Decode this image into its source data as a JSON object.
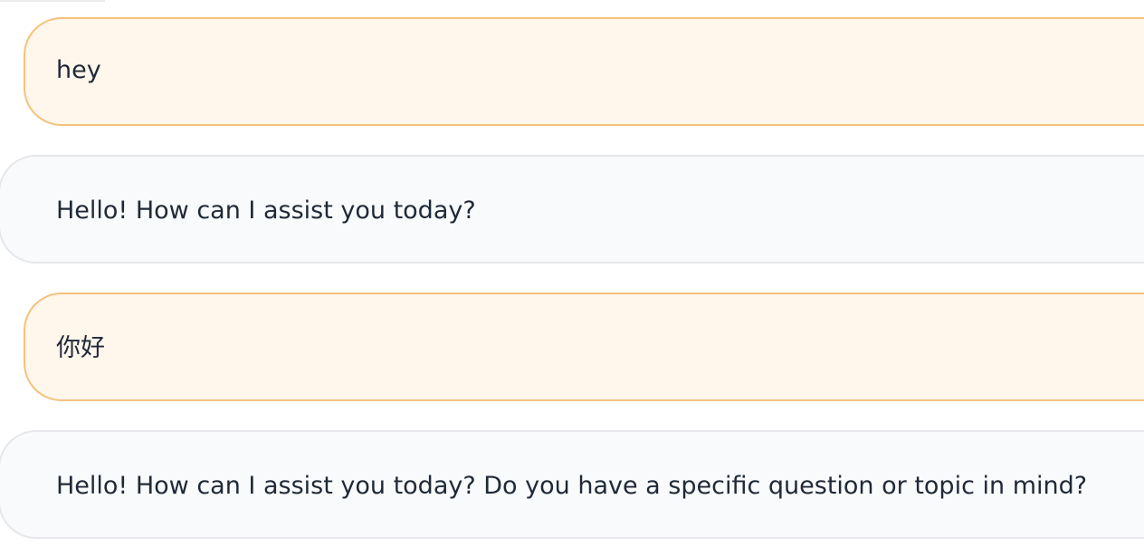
{
  "chat": {
    "messages": [
      {
        "role": "user",
        "text": "hey"
      },
      {
        "role": "assistant",
        "text": "Hello! How can I assist you today?"
      },
      {
        "role": "user",
        "text": "你好"
      },
      {
        "role": "assistant",
        "text": "Hello! How can I assist you today? Do you have a specific question or topic in mind?"
      }
    ]
  },
  "colors": {
    "user_bubble_bg": "#fff6ec",
    "user_bubble_border": "#f5c27c",
    "bot_bubble_bg": "#f9fafb",
    "bot_bubble_border": "#e5e7eb",
    "text": "#1f2937"
  }
}
